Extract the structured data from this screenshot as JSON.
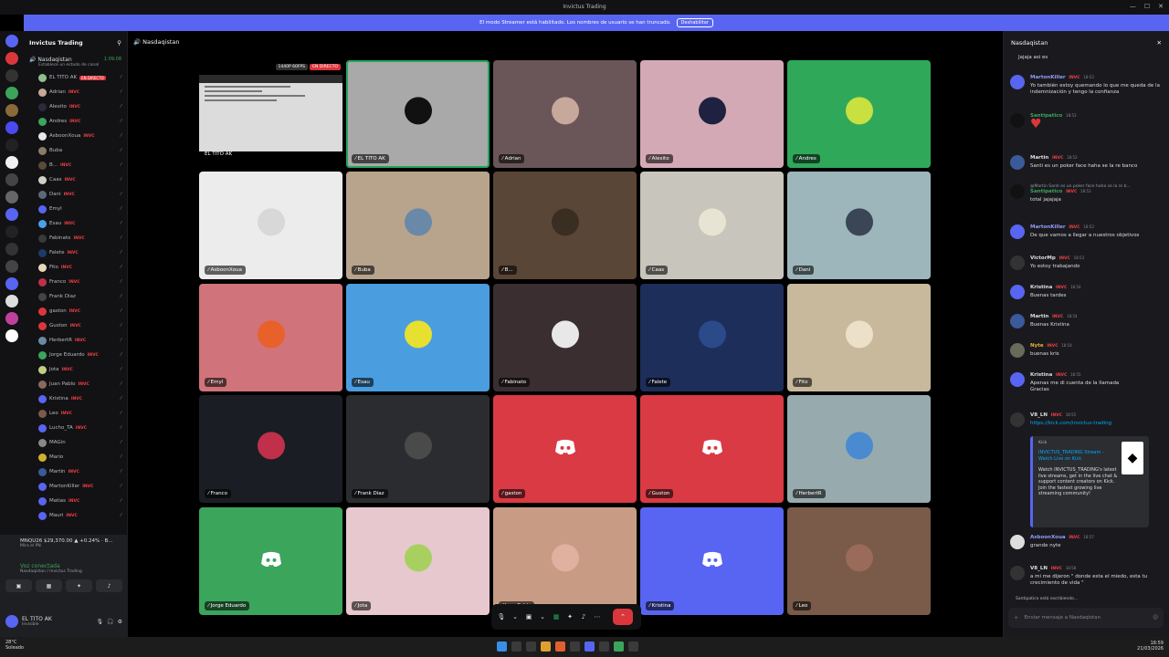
{
  "window": {
    "title": "Invictus Trading"
  },
  "banner": {
    "text": "El modo Streamer está habilitado. Los nombres de usuario se han truncado.",
    "button": "Deshabilitar"
  },
  "server": {
    "name": "Invictus Trading"
  },
  "voice_channel": {
    "name": "Nasdaqistan",
    "timer": "1:09:08",
    "subtitle": "Establece un estado de canal"
  },
  "members": [
    {
      "name": "EL TITO AK",
      "tag": "",
      "live": "EN DIRECTO",
      "color": "#8fbf8f"
    },
    {
      "name": "Adrian",
      "tag": "INVC",
      "live": "",
      "color": "#c7a89a"
    },
    {
      "name": "Alexito",
      "tag": "INVC",
      "live": "",
      "color": "#2a2a3a"
    },
    {
      "name": "Andres",
      "tag": "INVC",
      "live": "",
      "color": "#3ba55c"
    },
    {
      "name": "AsboonXoua",
      "tag": "INVC",
      "live": "",
      "color": "#e8e8e8"
    },
    {
      "name": "Buba",
      "tag": "",
      "live": "",
      "color": "#8a7a6a"
    },
    {
      "name": "B...",
      "tag": "INVC",
      "live": "",
      "color": "#5a4a3a"
    },
    {
      "name": "Caas",
      "tag": "INVC",
      "live": "",
      "color": "#d0d0c8"
    },
    {
      "name": "Dani",
      "tag": "INVC",
      "live": "",
      "color": "#5a6a7a"
    },
    {
      "name": "Emyl",
      "tag": "",
      "live": "",
      "color": "#5865f2"
    },
    {
      "name": "Esau",
      "tag": "INVC",
      "live": "",
      "color": "#4aa0e8"
    },
    {
      "name": "Fabinato",
      "tag": "INVC",
      "live": "",
      "color": "#3a3a3a"
    },
    {
      "name": "Falete",
      "tag": "INVC",
      "live": "",
      "color": "#1e3a6a"
    },
    {
      "name": "Fito",
      "tag": "INVC",
      "live": "",
      "color": "#e8d8b8"
    },
    {
      "name": "Franco",
      "tag": "INVC",
      "live": "",
      "color": "#c0304a"
    },
    {
      "name": "Frank Diaz",
      "tag": "",
      "live": "",
      "color": "#444"
    },
    {
      "name": "gaston",
      "tag": "INVC",
      "live": "",
      "color": "#da373c"
    },
    {
      "name": "Guston",
      "tag": "INVC",
      "live": "",
      "color": "#da373c"
    },
    {
      "name": "HerbertR",
      "tag": "INVC",
      "live": "",
      "color": "#6a8aa0"
    },
    {
      "name": "Jorge Eduardo",
      "tag": "INVC",
      "live": "",
      "color": "#3ba55c"
    },
    {
      "name": "Jota",
      "tag": "INVC",
      "live": "",
      "color": "#c0d080"
    },
    {
      "name": "Juan Pablo",
      "tag": "INVC",
      "live": "",
      "color": "#8a6a5a"
    },
    {
      "name": "Kristina",
      "tag": "INVC",
      "live": "",
      "color": "#5865f2"
    },
    {
      "name": "Leo",
      "tag": "INVC",
      "live": "",
      "color": "#7a5a4a"
    },
    {
      "name": "Lucho_TA",
      "tag": "INVC",
      "live": "",
      "color": "#5865f2"
    },
    {
      "name": "MAGin",
      "tag": "",
      "live": "",
      "color": "#888"
    },
    {
      "name": "Mario",
      "tag": "",
      "live": "",
      "color": "#d0b030"
    },
    {
      "name": "Martin",
      "tag": "INVC",
      "live": "",
      "color": "#3a5a9a"
    },
    {
      "name": "MartonKiller",
      "tag": "INVC",
      "live": "",
      "color": "#5865f2"
    },
    {
      "name": "Matias",
      "tag": "INVC",
      "live": "",
      "color": "#5865f2"
    },
    {
      "name": "Mauri",
      "tag": "INVC",
      "live": "",
      "color": "#5865f2"
    }
  ],
  "ticker": {
    "text": "MNQU26 $29,370.00 ▲ +0.24% · B...",
    "sub": "Mira el PN"
  },
  "voice_panel": {
    "status": "Voz conectada",
    "sub": "Nasdaqistan / Invictus Trading"
  },
  "user_panel": {
    "name": "EL TITO AK",
    "status": "Invisible"
  },
  "stage": {
    "header": "Nasdaqistan"
  },
  "screen_share": {
    "name": "EL TITO AK",
    "quality": "1440P 60FPS",
    "live": "EN DIRECTO"
  },
  "tiles": [
    {
      "name": "EL TITO AK",
      "bg": "#a9a9a9",
      "av": "#111",
      "speaking": true,
      "discord": false
    },
    {
      "name": "Adrian",
      "bg": "#6a5558",
      "av": "#c7a89a",
      "speaking": false,
      "discord": false
    },
    {
      "name": "Alexito",
      "bg": "#d4a9b6",
      "av": "#1e2240",
      "speaking": false,
      "discord": false
    },
    {
      "name": "Andres",
      "bg": "#2fa85a",
      "av": "#c8e040",
      "speaking": false,
      "discord": false
    },
    {
      "name": "AsboonXoua",
      "bg": "#ececec",
      "av": "#d8d8d8",
      "speaking": false,
      "discord": false
    },
    {
      "name": "Buba",
      "bg": "#b8a48c",
      "av": "#6a88a8",
      "speaking": false,
      "discord": false
    },
    {
      "name": "B...",
      "bg": "#5a4636",
      "av": "#3a2e22",
      "speaking": false,
      "discord": false
    },
    {
      "name": "Caas",
      "bg": "#c8c6bc",
      "av": "#e8e4d4",
      "speaking": false,
      "discord": false
    },
    {
      "name": "Dani",
      "bg": "#9cb6bc",
      "av": "#3a4656",
      "speaking": false,
      "discord": false
    },
    {
      "name": "Emyl",
      "bg": "#d0737a",
      "av": "#e8602a",
      "speaking": false,
      "discord": false
    },
    {
      "name": "Esau",
      "bg": "#4a9ee0",
      "av": "#e8e030",
      "speaking": false,
      "discord": false
    },
    {
      "name": "Fabinato",
      "bg": "#3a2e30",
      "av": "#e8e8e8",
      "speaking": false,
      "discord": false
    },
    {
      "name": "Falete",
      "bg": "#1e2e5a",
      "av": "#2a4a8a",
      "speaking": false,
      "discord": false
    },
    {
      "name": "Fito",
      "bg": "#c8b89c",
      "av": "#ece0c8",
      "speaking": false,
      "discord": false
    },
    {
      "name": "Franco",
      "bg": "#1a1e24",
      "av": "#c0304a",
      "speaking": false,
      "discord": false
    },
    {
      "name": "Frank Diaz",
      "bg": "#2a2c30",
      "av": "#4a4a4a",
      "speaking": false,
      "discord": false
    },
    {
      "name": "gaston",
      "bg": "#da3a44",
      "av": "",
      "speaking": false,
      "discord": true
    },
    {
      "name": "Guston",
      "bg": "#da3a44",
      "av": "",
      "speaking": false,
      "discord": true
    },
    {
      "name": "HerbertR",
      "bg": "#97abae",
      "av": "#4a8ad0",
      "speaking": false,
      "discord": false
    },
    {
      "name": "Jorge Eduardo",
      "bg": "#3ba55c",
      "av": "",
      "speaking": false,
      "discord": true
    },
    {
      "name": "Jota",
      "bg": "#e6c8ce",
      "av": "#a8d060",
      "speaking": false,
      "discord": false
    },
    {
      "name": "Juan Pablo",
      "bg": "#c89c84",
      "av": "#e0b0a0",
      "speaking": false,
      "discord": false
    },
    {
      "name": "Kristina",
      "bg": "#5865f2",
      "av": "",
      "speaking": false,
      "discord": true
    },
    {
      "name": "Leo",
      "bg": "#7a5a48",
      "av": "#9a6a5a",
      "speaking": false,
      "discord": false
    }
  ],
  "chat": {
    "header": "Nasdaqistan",
    "input_placeholder": "Enviar mensaje a Nasdaqistan",
    "first_line": "Jajaja asi es",
    "messages": [
      {
        "author": "MartonKiller",
        "tag": "INVC",
        "time": "18:53",
        "text": "Yo también estoy quemando lo que me queda de la indemnización y tengo la confianza",
        "color": "#5865f2",
        "author_color": "#949cf7"
      },
      {
        "author": "Santipatico",
        "tag": "",
        "time": "18:53",
        "text": "♥",
        "color": "#111",
        "author_color": "#3ba55c"
      },
      {
        "author": "Martin",
        "tag": "INVC",
        "time": "18:53",
        "text": "Santi es un poker face haha se la re banco",
        "color": "#3a5a9a",
        "author_color": "#dbdee1"
      },
      {
        "author": "Santipatico",
        "tag": "INVC",
        "time": "18:53",
        "text": "total jajajaja",
        "color": "#111",
        "author_color": "#3ba55c",
        "reply": "@Martin Santi es un poker face haha se la re b..."
      },
      {
        "author": "MartonKiller",
        "tag": "INVC",
        "time": "18:53",
        "text": "De que vamos a llegar a nuestros objetivos",
        "color": "#5865f2",
        "author_color": "#949cf7"
      },
      {
        "author": "VictorMp",
        "tag": "INVC",
        "time": "18:53",
        "text": "Yo estoy trabajando",
        "color": "#333",
        "author_color": "#dbdee1"
      },
      {
        "author": "Kristina",
        "tag": "INVC",
        "time": "18:54",
        "text": "Buenas tardes",
        "color": "#5865f2",
        "author_color": "#dbdee1"
      },
      {
        "author": "Martin",
        "tag": "INVC",
        "time": "18:54",
        "text": "Buenas Kristina",
        "color": "#3a5a9a",
        "author_color": "#dbdee1"
      },
      {
        "author": "Nyte",
        "tag": "INVC",
        "time": "18:54",
        "text": "buenas kris",
        "color": "#6a6a5a",
        "author_color": "#f0b232"
      },
      {
        "author": "Kristina",
        "tag": "INVC",
        "time": "18:55",
        "text": "Apenas me di cuenta de la llamada\nGracias",
        "color": "#5865f2",
        "author_color": "#dbdee1"
      },
      {
        "author": "V8_LN",
        "tag": "INVC",
        "time": "18:55",
        "text": "https://kick.com/invictus-trading",
        "color": "#333",
        "author_color": "#dbdee1"
      },
      {
        "author": "AsboonXoua",
        "tag": "INVC",
        "time": "18:57",
        "text": "grande nyte",
        "color": "#ddd",
        "author_color": "#949cf7"
      },
      {
        "author": "V8_LN",
        "tag": "INVC",
        "time": "18:58",
        "text": "a mi me dijeron \" donde esta el miedo, esta tu crecimiento de vida \"",
        "color": "#333",
        "author_color": "#dbdee1"
      }
    ],
    "embed": {
      "provider": "Kick",
      "title": "INVICTUS_TRADING Stream - Watch Live on Kick",
      "desc": "Watch INVICTUS_TRADING's latest live streams, get in the live chat & support content creators on Kick. Join the fastest growing live streaming community!"
    },
    "typing": "Santipatico está escribiendo..."
  },
  "taskbar": {
    "temp": "28°C",
    "weather": "Soleado",
    "time": "18:59",
    "date": "21/03/2026"
  }
}
